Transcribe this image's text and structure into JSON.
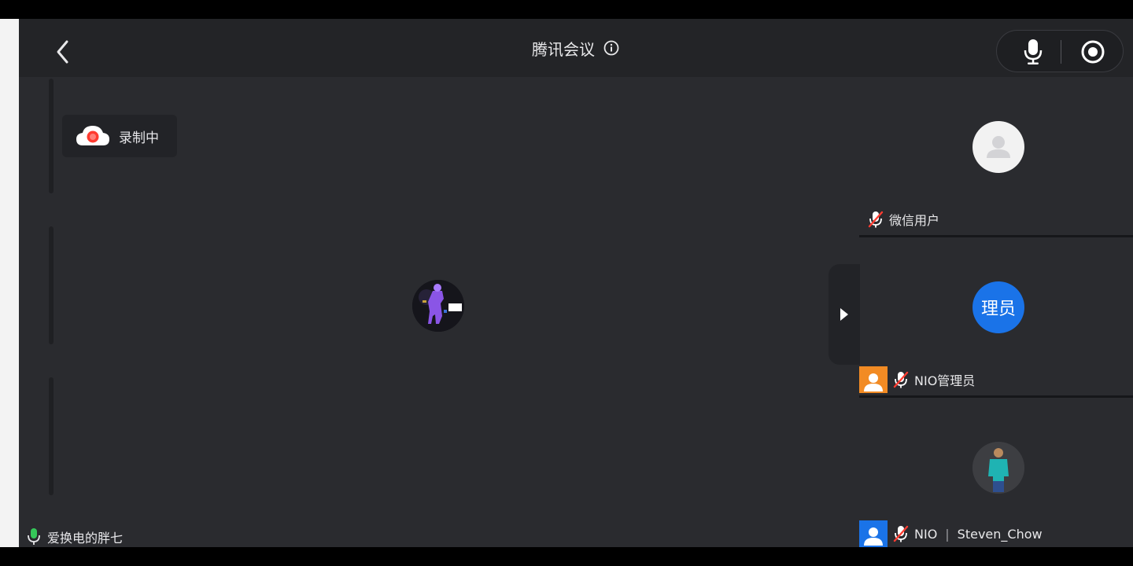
{
  "header": {
    "title": "腾讯会议",
    "icons": {
      "back": "chevron-left-icon",
      "info": "info-icon",
      "mic": "microphone-icon",
      "record": "record-icon"
    }
  },
  "recording": {
    "label": "录制中",
    "icon": "cloud-record-icon"
  },
  "speaker": {
    "name": "爱换电的胖七",
    "icon": "microphone-active-icon"
  },
  "participants": [
    {
      "name": "微信用户",
      "avatar": "default-user-avatar",
      "mic": "muted"
    },
    {
      "name": "NIO管理员",
      "avatar_text": "理员",
      "badge": "host-badge-icon",
      "mic": "muted"
    },
    {
      "name_org": "NIO",
      "name_user": "Steven_Chow",
      "avatar": "photo-avatar",
      "badge": "cohost-badge-icon",
      "mic": "muted"
    }
  ],
  "colors": {
    "stage": "#2a2b2f",
    "topbar": "#232427",
    "text": "#e8e8ea",
    "accent_blue": "#1a73e8",
    "record_red": "#ff3b30",
    "mic_green": "#35c759",
    "host_orange": "#f28b24",
    "cohost_blue": "#1a73e8"
  }
}
